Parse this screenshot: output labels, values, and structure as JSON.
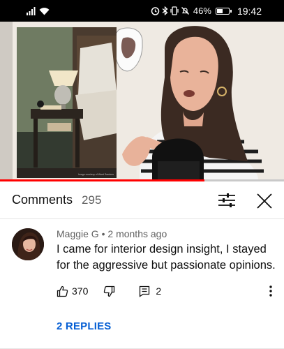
{
  "status_bar": {
    "battery_percent": "46%",
    "battery_level": 0.46,
    "time": "19:42",
    "icons": [
      "signal-icon",
      "wifi-icon",
      "alarm-icon",
      "bluetooth-icon",
      "vibrate-icon",
      "mute-icon",
      "battery-icon"
    ]
  },
  "video": {
    "progress": 0.72,
    "inset_caption": "Image courtesy of Ward Sanders"
  },
  "comments_panel": {
    "title": "Comments",
    "count": "295",
    "icons": [
      "filter-icon",
      "close-icon"
    ]
  },
  "comment": {
    "author": "Maggie G",
    "separator": "•",
    "time": "2 months ago",
    "text": "I came for interior design insight, I stayed for the aggressive but passionate opinions.",
    "likes": "370",
    "replies_count": "2",
    "replies_label": "2 REPLIES",
    "icons": [
      "thumbs-up-icon",
      "thumbs-down-icon",
      "reply-icon",
      "more-vertical-icon"
    ]
  },
  "colors": {
    "accent_red": "#ff0000",
    "link_blue": "#065fd4",
    "text_primary": "#0f0f0f",
    "text_secondary": "#606060"
  }
}
